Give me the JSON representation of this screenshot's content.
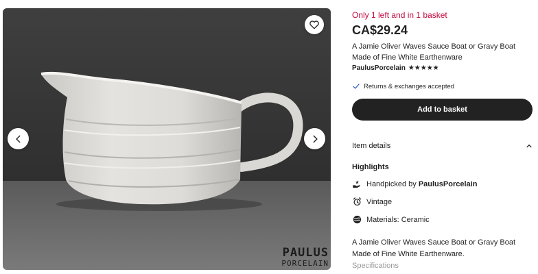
{
  "gallery": {
    "favorite_icon": "heart-outline-icon",
    "prev_icon": "chevron-left-icon",
    "next_icon": "chevron-right-icon",
    "watermark_line1": "PAULUS",
    "watermark_line2": "PORCELAIN"
  },
  "listing": {
    "stock_notice": "Only 1 left and in 1 basket",
    "price": "CA$29.24",
    "title": "A Jamie Oliver Waves Sauce Boat or Gravy Boat Made of Fine White Earthenware",
    "shop_name": "PaulusPorcelain",
    "rating_stars": "★★★★★",
    "returns_text": "Returns & exchanges accepted",
    "add_to_basket_label": "Add to basket"
  },
  "details": {
    "section_label": "Item details",
    "highlights_heading": "Highlights",
    "handpicked_prefix": "Handpicked by ",
    "handpicked_shop": "PaulusPorcelain",
    "vintage_label": "Vintage",
    "materials_label": "Materials: Ceramic",
    "description": "A Jamie Oliver Waves Sauce Boat or Gravy Boat Made of Fine White Earthenware.",
    "specifications_label": "Specifications"
  },
  "colors": {
    "stock_red": "#c3073b",
    "button_dark": "#222222",
    "text": "#222222",
    "muted": "#9a9a9a"
  }
}
